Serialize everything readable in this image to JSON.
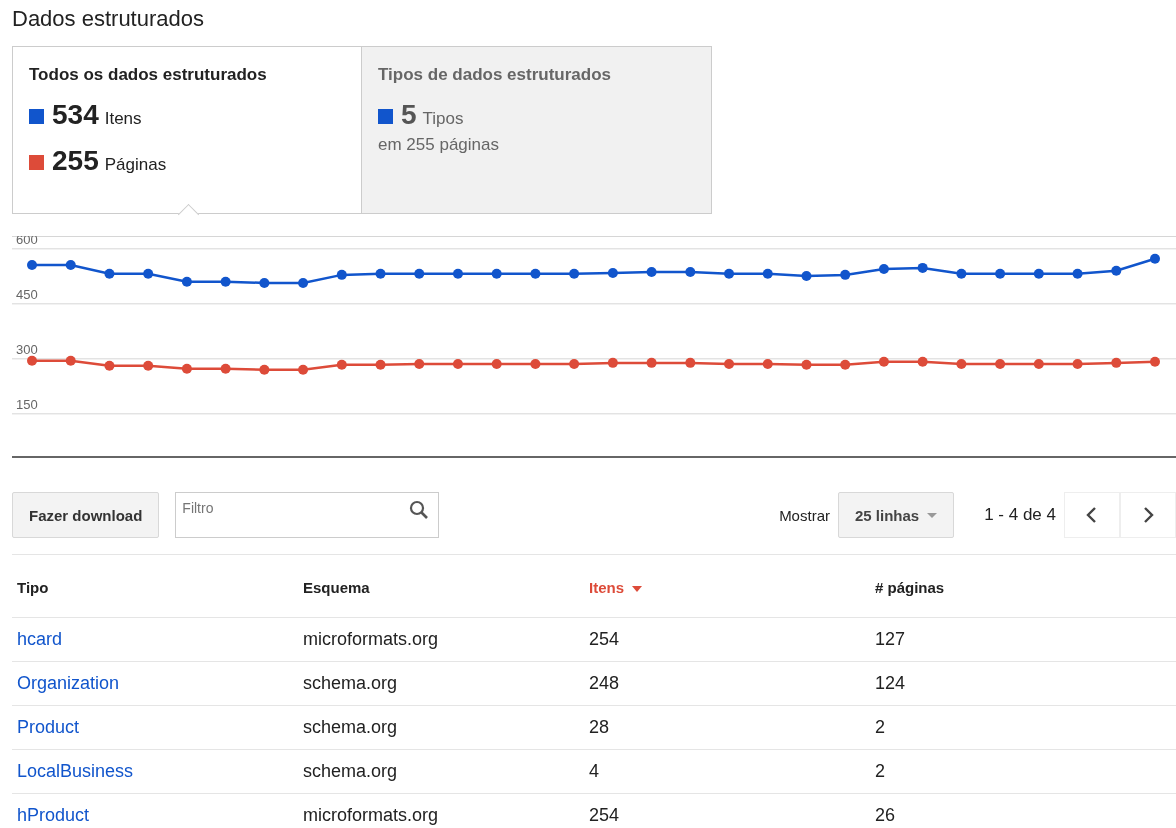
{
  "title": "Dados estruturados",
  "tabs": [
    {
      "selected": true,
      "heading": "Todos os dados estruturados",
      "metrics": [
        {
          "value": "534",
          "unit": "Itens",
          "color": "#1155cc"
        },
        {
          "value": "255",
          "unit": "Páginas",
          "color": "#dd4b39"
        }
      ]
    },
    {
      "selected": false,
      "heading": "Tipos de dados estruturados",
      "metrics": [
        {
          "value": "5",
          "unit": "Tipos",
          "color": "#1155cc"
        }
      ],
      "note": "em 255 páginas"
    }
  ],
  "chart": {
    "chart_data": {
      "type": "line",
      "grid": true,
      "ylim": [
        35,
        635
      ],
      "yticks": [
        150,
        300,
        450,
        600
      ],
      "series": [
        {
          "color": "#1155cc",
          "marker": true,
          "values": [
            556,
            556,
            532,
            532,
            510,
            510,
            507,
            507,
            529,
            532,
            532,
            532,
            532,
            532,
            532,
            534,
            537,
            537,
            532,
            532,
            526,
            529,
            545,
            548,
            532,
            532,
            532,
            532,
            540,
            573
          ]
        },
        {
          "color": "#dd4b39",
          "marker": true,
          "values": [
            295,
            295,
            281,
            281,
            273,
            273,
            270,
            270,
            284,
            284,
            286,
            286,
            286,
            286,
            286,
            289,
            289,
            289,
            286,
            286,
            284,
            284,
            292,
            292,
            286,
            286,
            286,
            286,
            289,
            292
          ]
        }
      ]
    }
  },
  "toolbar": {
    "download": "Fazer download",
    "filter_placeholder": "Filtro",
    "show_label": "Mostrar",
    "rows_option": "25 linhas",
    "range": "1 - 4 de 4"
  },
  "table": {
    "columns": [
      {
        "label": "Tipo",
        "sorted": false
      },
      {
        "label": "Esquema",
        "sorted": false
      },
      {
        "label": "Itens",
        "sorted": true
      },
      {
        "label": "# páginas",
        "sorted": false
      }
    ],
    "rows": [
      [
        "hcard",
        "microformats.org",
        "254",
        "127"
      ],
      [
        "Organization",
        "schema.org",
        "248",
        "124"
      ],
      [
        "Product",
        "schema.org",
        "28",
        "2"
      ],
      [
        "LocalBusiness",
        "schema.org",
        "4",
        "2"
      ],
      [
        "hProduct",
        "microformats.org",
        "254",
        "26"
      ]
    ]
  }
}
